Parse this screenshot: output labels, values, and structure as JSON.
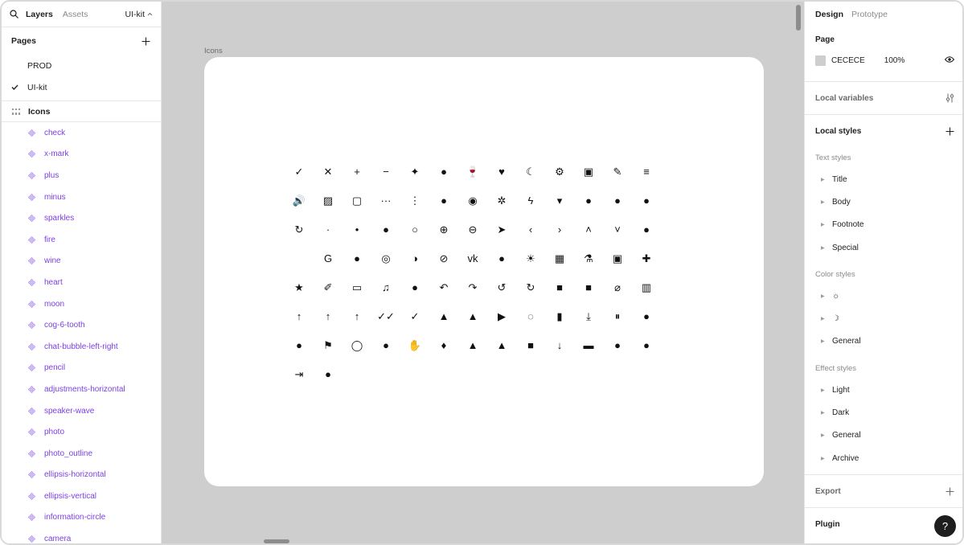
{
  "left": {
    "tabs": {
      "layers": "Layers",
      "assets": "Assets",
      "kit": "UI-kit"
    },
    "pages_title": "Pages",
    "pages": [
      {
        "label": "PROD",
        "checked": false
      },
      {
        "label": "UI-kit",
        "checked": true
      }
    ],
    "frame": "Icons",
    "layers": [
      "check",
      "x-mark",
      "plus",
      "minus",
      "sparkles",
      "fire",
      "wine",
      "heart",
      "moon",
      "cog-6-tooth",
      "chat-bubble-left-right",
      "pencil",
      "adjustments-horizontal",
      "speaker-wave",
      "photo",
      "photo_outline",
      "ellipsis-horizontal",
      "ellipsis-vertical",
      "information-circle",
      "camera"
    ]
  },
  "canvas": {
    "frame_label": "Icons",
    "background": "#cecece",
    "icons": [
      "✓",
      "✕",
      "+",
      "−",
      "✦",
      "●",
      "🍷",
      "♥",
      "☾",
      "⚙",
      "▣",
      "✎",
      "≡",
      "🔊",
      "▨",
      "▢",
      "···",
      "⋮",
      "●",
      "◉",
      "✲",
      "ϟ",
      "▾",
      "●",
      "●",
      "●",
      "↻",
      "·",
      "•",
      "●",
      "○",
      "⊕",
      "⊖",
      "➤",
      "‹",
      "›",
      "˄",
      "˅",
      "●",
      "",
      "G",
      "●",
      "◎",
      "◑",
      "⊘",
      "vk",
      "●",
      "☀",
      "▦",
      "⚗",
      "▣",
      "✚",
      "★",
      "✐",
      "▭",
      "♫",
      "●",
      "↶",
      "↷",
      "↺",
      "↻",
      "■",
      "■",
      "⌀",
      "▥",
      "↑",
      "↑",
      "↑",
      "✓✓",
      "✓",
      "▲",
      "▲",
      "▶",
      "◌",
      "▮",
      "⤓",
      "⏸",
      "●",
      "●",
      "⚑",
      "◯",
      "●",
      "✋",
      "♦",
      "▲",
      "▲",
      "■",
      "↓",
      "▬",
      "●",
      "●",
      "⇥",
      "●"
    ]
  },
  "right": {
    "tabs": {
      "design": "Design",
      "prototype": "Prototype"
    },
    "page": {
      "title": "Page",
      "color": "CECECE",
      "opacity": "100%"
    },
    "local_variables": "Local variables",
    "local_styles": "Local styles",
    "text_styles": {
      "title": "Text styles",
      "items": [
        "Title",
        "Body",
        "Footnote",
        "Special"
      ]
    },
    "color_styles": {
      "title": "Color styles",
      "items": [
        "☼",
        "☽",
        "General"
      ]
    },
    "effect_styles": {
      "title": "Effect styles",
      "items": [
        "Light",
        "Dark",
        "General",
        "Archive"
      ]
    },
    "export": "Export",
    "plugin": "Plugin",
    "help": "?"
  }
}
